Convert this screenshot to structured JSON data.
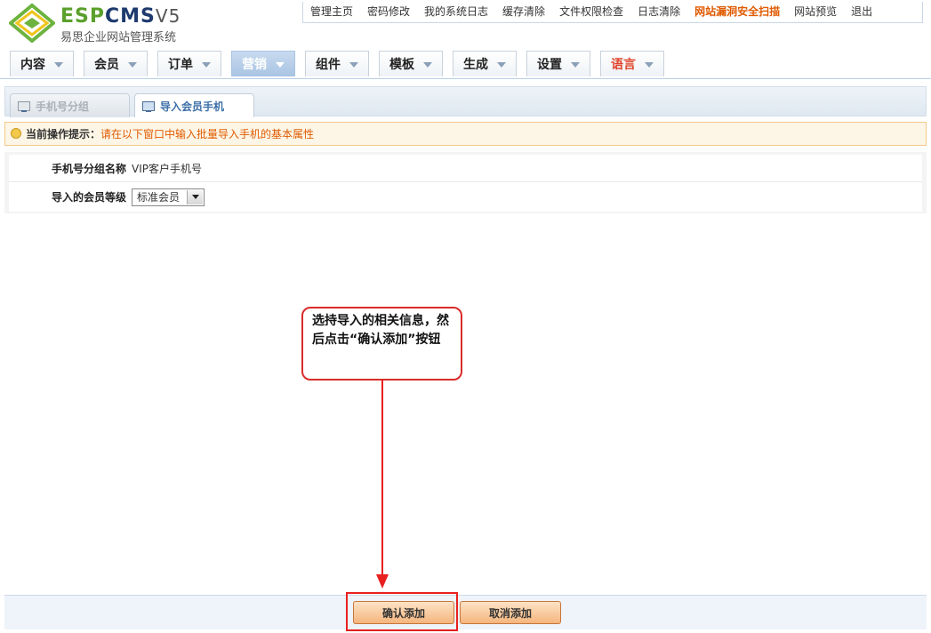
{
  "brand": {
    "logo_main": "ESP",
    "logo_cms": "CMS",
    "logo_version": "V5",
    "subtitle": "易思企业网站管理系统"
  },
  "top_links": [
    {
      "label": "管理主页"
    },
    {
      "label": "密码修改"
    },
    {
      "label": "我的系统日志"
    },
    {
      "label": "缓存清除"
    },
    {
      "label": "文件权限检查"
    },
    {
      "label": "日志清除"
    },
    {
      "label": "网站漏洞安全扫描",
      "highlight": true
    },
    {
      "label": "网站预览"
    },
    {
      "label": "退出"
    }
  ],
  "main_nav": [
    {
      "label": "内容"
    },
    {
      "label": "会员"
    },
    {
      "label": "订单"
    },
    {
      "label": "营销",
      "active": true
    },
    {
      "label": "组件"
    },
    {
      "label": "模板"
    },
    {
      "label": "生成"
    },
    {
      "label": "设置"
    },
    {
      "label": "语言",
      "color": "#e0452b"
    }
  ],
  "sub_tabs": [
    {
      "label": "手机号分组",
      "active": false
    },
    {
      "label": "导入会员手机",
      "active": true
    }
  ],
  "hint": {
    "label": "当前操作提示：",
    "text": "请在以下窗口中输入批量导入手机的基本属性",
    "icon": "lightbulb-icon"
  },
  "form": {
    "group_name_label": "手机号分组名称",
    "group_name_value": "VIP客户手机号",
    "member_level_label": "导入的会员等级",
    "member_level_value": "标准会员"
  },
  "annotation": {
    "text": "选持导入的相关信息，然后点击“确认添加”按钮",
    "color": "#e8201f"
  },
  "footer": {
    "confirm_label": "确认添加",
    "cancel_label": "取消添加"
  }
}
